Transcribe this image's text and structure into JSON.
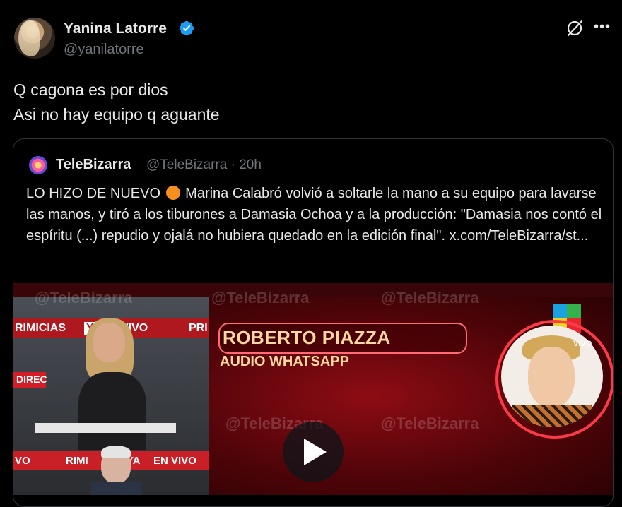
{
  "tweet": {
    "author_name": "Yanina Latorre",
    "author_handle": "@yanilatorre",
    "text_line1": "Q cagona es por dios",
    "text_line2": "Asi no hay equipo q aguante"
  },
  "quote": {
    "author_name": "TeleBizarra",
    "author_handle": "@TeleBizarra · 20h",
    "text_part1": "LO HIZO DE NUEVO",
    "text_part2": "Marina Calabró volvió a soltarle la mano a su equipo para lavarse las manos, y tiró a los tiburones a Damasia Ochoa y a la producción: \"Damasia nos contó el espíritu (...) repudio y ojalá no hubiera quedado en la edición final\".  x.com/TeleBizarra/st..."
  },
  "media": {
    "graphic_title": "ROBERTO PIAZZA",
    "graphic_subtitle": "AUDIO WHATSAPP",
    "live_badge": "VIVO",
    "studio_banner_top_left": "RIMICIAS",
    "studio_banner_top_mid": "YA",
    "studio_banner_top_right": "N VIVO",
    "studio_banner_top_far": "PRI",
    "studio_banner_bottom_left": "VO",
    "studio_banner_bottom_mid": "RIMI",
    "studio_banner_bottom_ya": "YA",
    "studio_banner_bottom_right": "EN VIVO",
    "directo_label": "DIREC",
    "watermark": "@TeleBizarra"
  },
  "icons": {
    "verified": "verified-badge-icon",
    "grok": "grok-icon",
    "more": "more-options-icon",
    "play": "play-icon"
  },
  "colors": {
    "background": "#000000",
    "verified_blue": "#1d9bf0",
    "muted_text": "#71767b",
    "orange_dot": "#f5901e"
  }
}
